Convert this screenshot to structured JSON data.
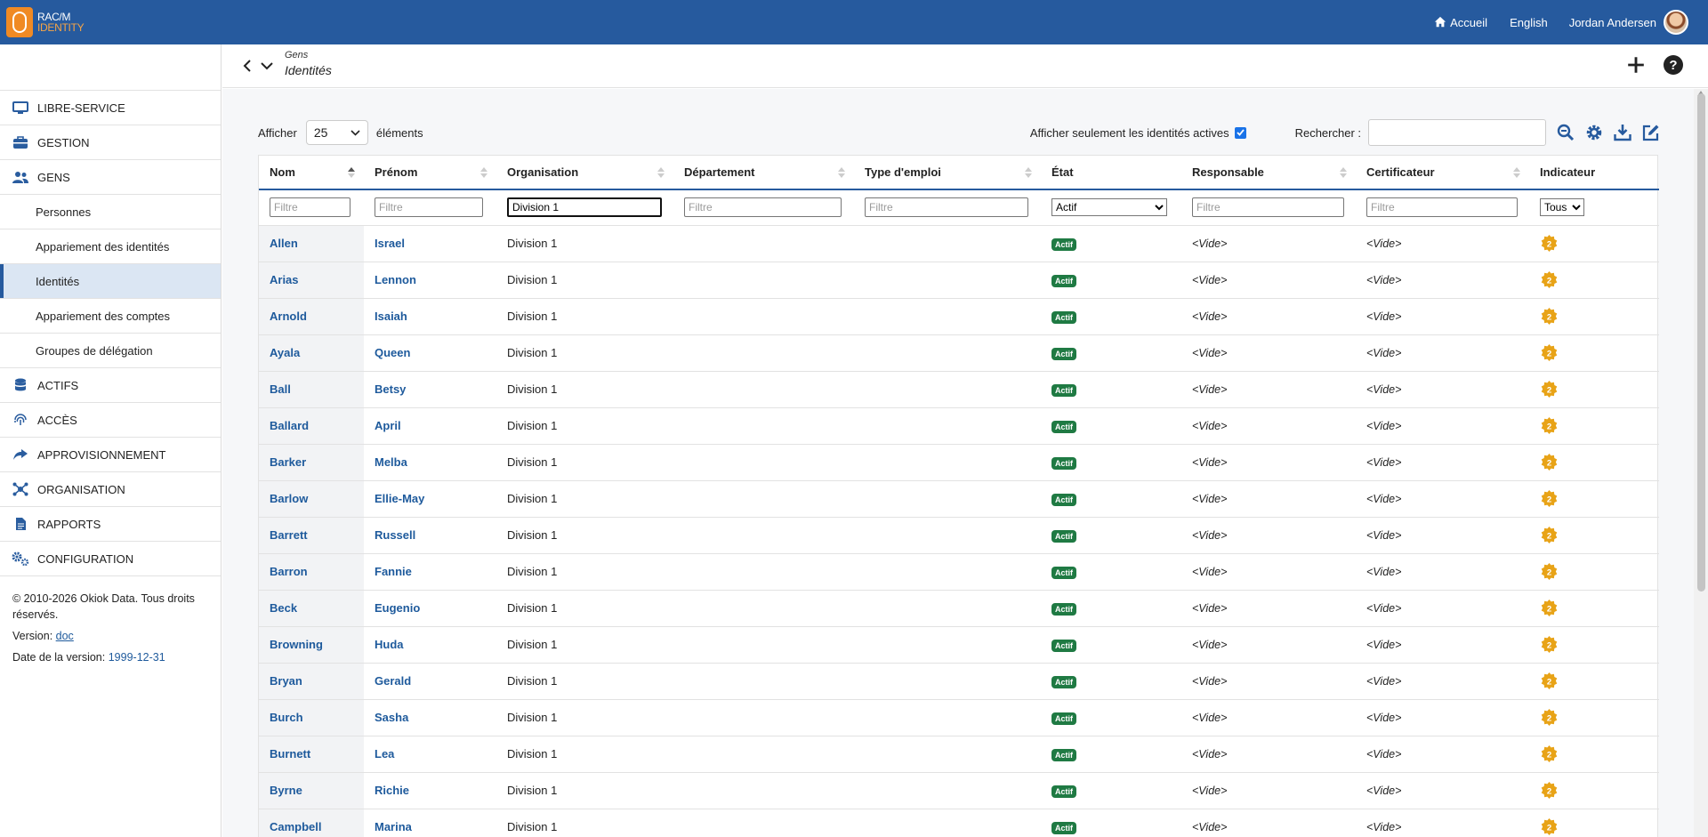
{
  "topbar": {
    "logo_line1": "RAC/M",
    "logo_line2": "IDENTITY",
    "home": "Accueil",
    "language": "English",
    "user": "Jordan Andersen"
  },
  "sidebar": {
    "items": [
      {
        "label": "LIBRE-SERVICE",
        "icon": "monitor-icon"
      },
      {
        "label": "GESTION",
        "icon": "toolbox-icon"
      },
      {
        "label": "GENS",
        "icon": "users-icon"
      },
      {
        "label": "Personnes",
        "sub": true
      },
      {
        "label": "Appariement des identités",
        "sub": true
      },
      {
        "label": "Identités",
        "sub": true,
        "active": true
      },
      {
        "label": "Appariement des comptes",
        "sub": true
      },
      {
        "label": "Groupes de délégation",
        "sub": true
      },
      {
        "label": "ACTIFS",
        "icon": "database-icon"
      },
      {
        "label": "ACCÈS",
        "icon": "fingerprint-icon"
      },
      {
        "label": "APPROVISIONNEMENT",
        "icon": "share-icon"
      },
      {
        "label": "ORGANISATION",
        "icon": "network-icon"
      },
      {
        "label": "RAPPORTS",
        "icon": "report-icon"
      },
      {
        "label": "CONFIGURATION",
        "icon": "gears-icon"
      }
    ],
    "footer": {
      "copyright": "© 2010-2026 Okiok Data. Tous droits réservés.",
      "version_label": "Version:",
      "version_link": "doc",
      "date_label": "Date de la version:",
      "date_value": "1999-12-31"
    }
  },
  "header": {
    "breadcrumb_parent": "Gens",
    "title": "Identités"
  },
  "toolbar": {
    "show_label": "Afficher",
    "page_size": "25",
    "elements_label": "éléments",
    "active_only_label": "Afficher seulement les identités actives",
    "active_only_checked": true,
    "search_label": "Rechercher :",
    "search_value": ""
  },
  "table": {
    "columns": [
      "Nom",
      "Prénom",
      "Organisation",
      "Département",
      "Type d'emploi",
      "État",
      "Responsable",
      "Certificateur",
      "Indicateur"
    ],
    "filter_placeholder": "Filtre",
    "filters": {
      "organisation": "Division 1",
      "etat": "Actif",
      "indicateur": "Tous"
    },
    "rows": [
      {
        "nom": "Allen",
        "prenom": "Israel",
        "organisation": "Division 1",
        "departement": "",
        "type": "",
        "etat": "Actif",
        "responsable": "<Vide>",
        "certificateur": "<Vide>"
      },
      {
        "nom": "Arias",
        "prenom": "Lennon",
        "organisation": "Division 1",
        "departement": "",
        "type": "",
        "etat": "Actif",
        "responsable": "<Vide>",
        "certificateur": "<Vide>"
      },
      {
        "nom": "Arnold",
        "prenom": "Isaiah",
        "organisation": "Division 1",
        "departement": "",
        "type": "",
        "etat": "Actif",
        "responsable": "<Vide>",
        "certificateur": "<Vide>"
      },
      {
        "nom": "Ayala",
        "prenom": "Queen",
        "organisation": "Division 1",
        "departement": "",
        "type": "",
        "etat": "Actif",
        "responsable": "<Vide>",
        "certificateur": "<Vide>"
      },
      {
        "nom": "Ball",
        "prenom": "Betsy",
        "organisation": "Division 1",
        "departement": "",
        "type": "",
        "etat": "Actif",
        "responsable": "<Vide>",
        "certificateur": "<Vide>"
      },
      {
        "nom": "Ballard",
        "prenom": "April",
        "organisation": "Division 1",
        "departement": "",
        "type": "",
        "etat": "Actif",
        "responsable": "<Vide>",
        "certificateur": "<Vide>"
      },
      {
        "nom": "Barker",
        "prenom": "Melba",
        "organisation": "Division 1",
        "departement": "",
        "type": "",
        "etat": "Actif",
        "responsable": "<Vide>",
        "certificateur": "<Vide>"
      },
      {
        "nom": "Barlow",
        "prenom": "Ellie-May",
        "organisation": "Division 1",
        "departement": "",
        "type": "",
        "etat": "Actif",
        "responsable": "<Vide>",
        "certificateur": "<Vide>"
      },
      {
        "nom": "Barrett",
        "prenom": "Russell",
        "organisation": "Division 1",
        "departement": "",
        "type": "",
        "etat": "Actif",
        "responsable": "<Vide>",
        "certificateur": "<Vide>"
      },
      {
        "nom": "Barron",
        "prenom": "Fannie",
        "organisation": "Division 1",
        "departement": "",
        "type": "",
        "etat": "Actif",
        "responsable": "<Vide>",
        "certificateur": "<Vide>"
      },
      {
        "nom": "Beck",
        "prenom": "Eugenio",
        "organisation": "Division 1",
        "departement": "",
        "type": "",
        "etat": "Actif",
        "responsable": "<Vide>",
        "certificateur": "<Vide>"
      },
      {
        "nom": "Browning",
        "prenom": "Huda",
        "organisation": "Division 1",
        "departement": "",
        "type": "",
        "etat": "Actif",
        "responsable": "<Vide>",
        "certificateur": "<Vide>"
      },
      {
        "nom": "Bryan",
        "prenom": "Gerald",
        "organisation": "Division 1",
        "departement": "",
        "type": "",
        "etat": "Actif",
        "responsable": "<Vide>",
        "certificateur": "<Vide>"
      },
      {
        "nom": "Burch",
        "prenom": "Sasha",
        "organisation": "Division 1",
        "departement": "",
        "type": "",
        "etat": "Actif",
        "responsable": "<Vide>",
        "certificateur": "<Vide>"
      },
      {
        "nom": "Burnett",
        "prenom": "Lea",
        "organisation": "Division 1",
        "departement": "",
        "type": "",
        "etat": "Actif",
        "responsable": "<Vide>",
        "certificateur": "<Vide>"
      },
      {
        "nom": "Byrne",
        "prenom": "Richie",
        "organisation": "Division 1",
        "departement": "",
        "type": "",
        "etat": "Actif",
        "responsable": "<Vide>",
        "certificateur": "<Vide>"
      },
      {
        "nom": "Campbell",
        "prenom": "Marina",
        "organisation": "Division 1",
        "departement": "",
        "type": "",
        "etat": "Actif",
        "responsable": "<Vide>",
        "certificateur": "<Vide>"
      }
    ],
    "indicator_icon": "warning-badge-icon",
    "indicator_value": "2"
  },
  "colors": {
    "topbar": "#265a9e",
    "link": "#1e5a9c",
    "badge": "#1f7a43",
    "indicator": "#e8a317"
  }
}
